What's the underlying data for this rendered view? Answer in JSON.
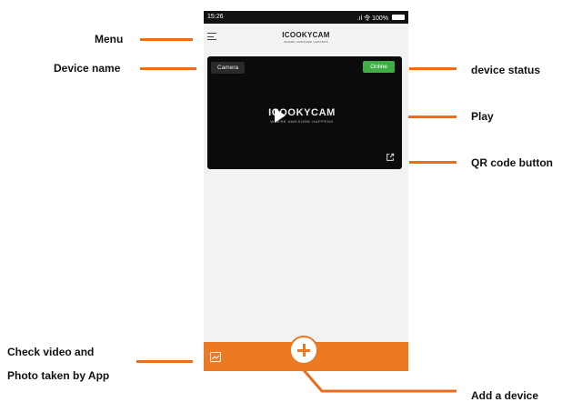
{
  "phone": {
    "status_bar": {
      "time": "15:26",
      "right": ".ıl 令 100%"
    },
    "app_title": "ICOOKYCAM",
    "app_tagline": "WHERE AWESOME HAPPENS",
    "device_card": {
      "device_name": "Camera",
      "status": "Online",
      "logo": "ICOOKYCAM",
      "logo_tagline": "WHERE AWESOME HAPPENS"
    },
    "icons": {
      "menu": "menu-icon",
      "play": "play-icon",
      "qr": "share-icon",
      "gallery": "image-icon",
      "add": "plus-icon"
    }
  },
  "callouts": {
    "menu": "Menu",
    "device_name": "Device name",
    "device_status": "device status",
    "play": "Play",
    "qr": "QR code button",
    "check_line1": "Check video and",
    "check_line2": "Photo taken by App",
    "add_device": "Add a device"
  },
  "colors": {
    "accent": "#ec7a23",
    "online": "#3fae45",
    "card": "#0b0b0b"
  }
}
